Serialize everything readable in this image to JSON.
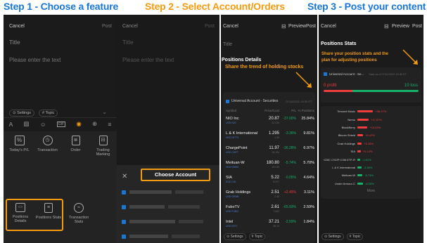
{
  "steps": [
    {
      "label": "Step 1 - Choose a feature",
      "color": "#1a77d6"
    },
    {
      "label": "Step 2 - Select Account/Orders",
      "color": "#f39c11"
    },
    {
      "label": "Step 3 - Post your content",
      "color": "#1a77d6"
    }
  ],
  "p1": {
    "cancel": "Cancel",
    "post": "Post",
    "title": "Title",
    "placeholder": "Please enter the text",
    "settings": "Settings",
    "topic": "Topic",
    "features": [
      {
        "label": "Today's P/L",
        "icon": "pl-icon"
      },
      {
        "label": "Transaction",
        "icon": "clock-icon"
      },
      {
        "label": "Order",
        "icon": "order-icon"
      },
      {
        "label": "Trading Marking",
        "icon": "bookmark-icon"
      },
      {
        "label": "Positions Details",
        "icon": "briefcase-icon"
      },
      {
        "label": "Positions Stats",
        "icon": "doc-icon"
      },
      {
        "label": "Transaction Stats",
        "icon": "chart-icon"
      }
    ]
  },
  "p2": {
    "cancel": "Cancel",
    "post": "Post",
    "title": "Title",
    "placeholder": "Please enter the text",
    "choose": "Choose Account"
  },
  "p3": {
    "cancel": "Cancel",
    "preview": "Preview",
    "post": "Post",
    "title": "Title",
    "section": "Positions Details",
    "annotation": "Share the trend of holding stocks",
    "account": "Universal Account - Securities",
    "asof": "07/11/2022 15:30 ET",
    "columns": [
      "Symbol",
      "Price/Cost",
      "P/L",
      "% Positions"
    ],
    "rows": [
      {
        "name": "NIO Inc",
        "code": "USD NIO",
        "price": "20.87",
        "cost": "22.038",
        "pl": "-37.00%",
        "pct": "25.84%",
        "up": false
      },
      {
        "name": "L & K International",
        "code": "HKD 00773",
        "price": "1.295",
        "cost": "1.58",
        "pl": "-3.36%",
        "pct": "9.81%",
        "up": false
      },
      {
        "name": "ChargePoint",
        "code": "USD CHPT",
        "price": "11.97",
        "cost": "18.154",
        "pl": "-36.28%",
        "pct": "6.97%",
        "up": false
      },
      {
        "name": "Meituan-W",
        "code": "HKD 03690",
        "price": "180.80",
        "cost": "191.80",
        "pl": "-5.74%",
        "pct": "5.70%",
        "up": false
      },
      {
        "name": "SIA",
        "code": "SGD C6L",
        "price": "5.22",
        "cost": "5.207",
        "pl": "-0.05%",
        "pct": "4.64%",
        "up": false
      },
      {
        "name": "Grab Holdings",
        "code": "USD GRAB",
        "price": "2.51",
        "cost": "2.45",
        "pl": "+2.45%",
        "pct": "3.11%",
        "up": true
      },
      {
        "name": "FuboTV",
        "code": "USD FUBO",
        "price": "2.61",
        "cost": "7.662",
        "pl": "-65.93%",
        "pct": "2.59%",
        "up": false
      },
      {
        "name": "Intel",
        "code": "USD INTC",
        "price": "37.21",
        "cost": "38.10",
        "pl": "-2.59%",
        "pct": "1.84%",
        "up": false
      }
    ],
    "settings": "Settings",
    "topic": "Topic"
  },
  "p4": {
    "cancel": "Cancel",
    "preview": "Preview",
    "post": "Post",
    "section": "Positions Stats",
    "annotation1": "Share your position stats and the",
    "annotation2": "plan for adjusting positions",
    "account": "Universal Account - Se...",
    "asof": "Data as of 07/11/2022 15:30 ET",
    "profit_label": "0 profit",
    "loss_label": "10 loss",
    "stats": [
      {
        "name": "Tencent Music",
        "pl": "+38.97%",
        "up": true,
        "bar": 0.28
      },
      {
        "name": "Nemo",
        "pl": "+17.57%",
        "up": true,
        "bar": 0.2
      },
      {
        "name": "BlackBerry",
        "pl": "+15.53%",
        "up": true,
        "bar": 0.18
      },
      {
        "name": "Bitcoin Shield",
        "pl": "+5.42%",
        "up": true,
        "bar": 0.1
      },
      {
        "name": "Grab Holdings",
        "pl": "+2.45%",
        "up": true,
        "bar": 0.08
      },
      {
        "name": "SIA",
        "pl": "+0.14%",
        "up": true,
        "bar": 0.06
      },
      {
        "name": "ICBC CSOP CGB ETF-R",
        "pl": "-1.61%",
        "up": false,
        "bar": 0.05
      },
      {
        "name": "L & K International",
        "pl": "-3.36%",
        "up": false,
        "bar": 0.07
      },
      {
        "name": "Meituan-W",
        "pl": "-5.74%",
        "up": false,
        "bar": 0.09
      },
      {
        "name": "Under Armour-C",
        "pl": "-6.05%",
        "up": false,
        "bar": 0.1
      }
    ],
    "more": "More",
    "settings": "Settings",
    "topic": "Topic"
  },
  "colors": {
    "orange": "#f39c11",
    "green": "#16b26a",
    "red": "#ef3c3c",
    "blue": "#1a77d6"
  }
}
